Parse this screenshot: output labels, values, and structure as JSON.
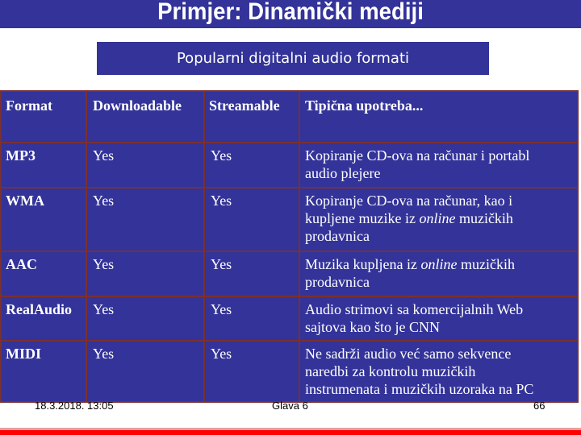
{
  "slide": {
    "title": "Primjer: Dinamički mediji",
    "subtitle": "Popularni digitalni audio formati"
  },
  "table": {
    "headers": [
      "Format",
      "Downloadable",
      "Streamable",
      "Tipična upotreba..."
    ],
    "rows": [
      {
        "format": "MP3",
        "downloadable": "Yes",
        "streamable": "Yes",
        "usage_lines": [
          [
            {
              "text": "Kopiranje CD-ova na računar i portabl"
            }
          ],
          [
            {
              "text": "audio plejere"
            }
          ]
        ]
      },
      {
        "format": "WMA",
        "downloadable": "Yes",
        "streamable": "Yes",
        "usage_lines": [
          [
            {
              "text": "Kopiranje CD-ova na računar, kao i"
            }
          ],
          [
            {
              "text": "kupljene muzike iz "
            },
            {
              "text": "online",
              "italic": true
            },
            {
              "text": " muzičkih"
            }
          ],
          [
            {
              "text": "prodavnica"
            }
          ]
        ]
      },
      {
        "format": "AAC",
        "downloadable": "Yes",
        "streamable": "Yes",
        "usage_lines": [
          [
            {
              "text": "Muzika kupljena iz "
            },
            {
              "text": "online",
              "italic": true
            },
            {
              "text": " muzičkih"
            }
          ],
          [
            {
              "text": "prodavnica"
            }
          ]
        ]
      },
      {
        "format": "RealAudio",
        "downloadable": "Yes",
        "streamable": "Yes",
        "usage_lines": [
          [
            {
              "text": "Audio strimovi sa komercijalnih Web"
            }
          ],
          [
            {
              "text": "sajtova kao što je CNN"
            }
          ]
        ]
      },
      {
        "format": "MIDI",
        "downloadable": "Yes",
        "streamable": "Yes",
        "usage_lines": [
          [
            {
              "text": "Ne sadrži audio već samo sekvence"
            }
          ],
          [
            {
              "text": "naredbi za kontrolu muzičkih"
            }
          ],
          [
            {
              "text": "instrumenata i muzičkih uzoraka na  PC"
            }
          ]
        ]
      }
    ]
  },
  "footer": {
    "date": "18.3.2018. 13:05",
    "chapter": "Glava 6",
    "page": "66"
  },
  "colors": {
    "primary": "#333399",
    "grid": "#7a3030",
    "accent_bar": "#ff0000"
  }
}
